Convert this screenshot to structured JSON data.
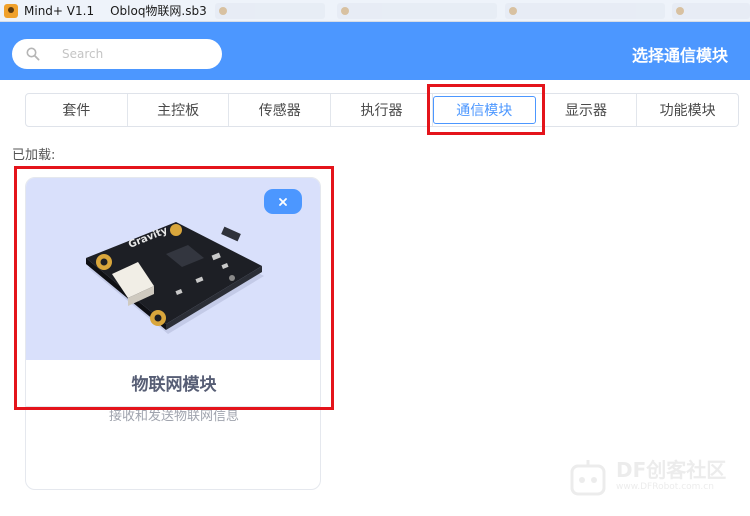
{
  "window": {
    "app_name": "Mind+ V1.1",
    "file_name": "Obloq物联网.sb3"
  },
  "header": {
    "search_placeholder": "Search",
    "title": "选择通信模块",
    "background_color": "#4c97ff"
  },
  "tabs": [
    {
      "label": "套件"
    },
    {
      "label": "主控板"
    },
    {
      "label": "传感器"
    },
    {
      "label": "执行器"
    },
    {
      "label": "通信模块",
      "active": true
    },
    {
      "label": "显示器"
    },
    {
      "label": "功能模块"
    }
  ],
  "loaded_label": "已加载:",
  "card": {
    "title": "物联网模块",
    "description": "接收和发送物联网信息",
    "board_label": "Gravity",
    "image_background": "#d9e0fb"
  },
  "watermark": {
    "text": "DF创客社区",
    "url": "www.DFRobot.com.cn"
  },
  "colors": {
    "accent": "#4c97ff",
    "highlight": "#e4141b"
  }
}
